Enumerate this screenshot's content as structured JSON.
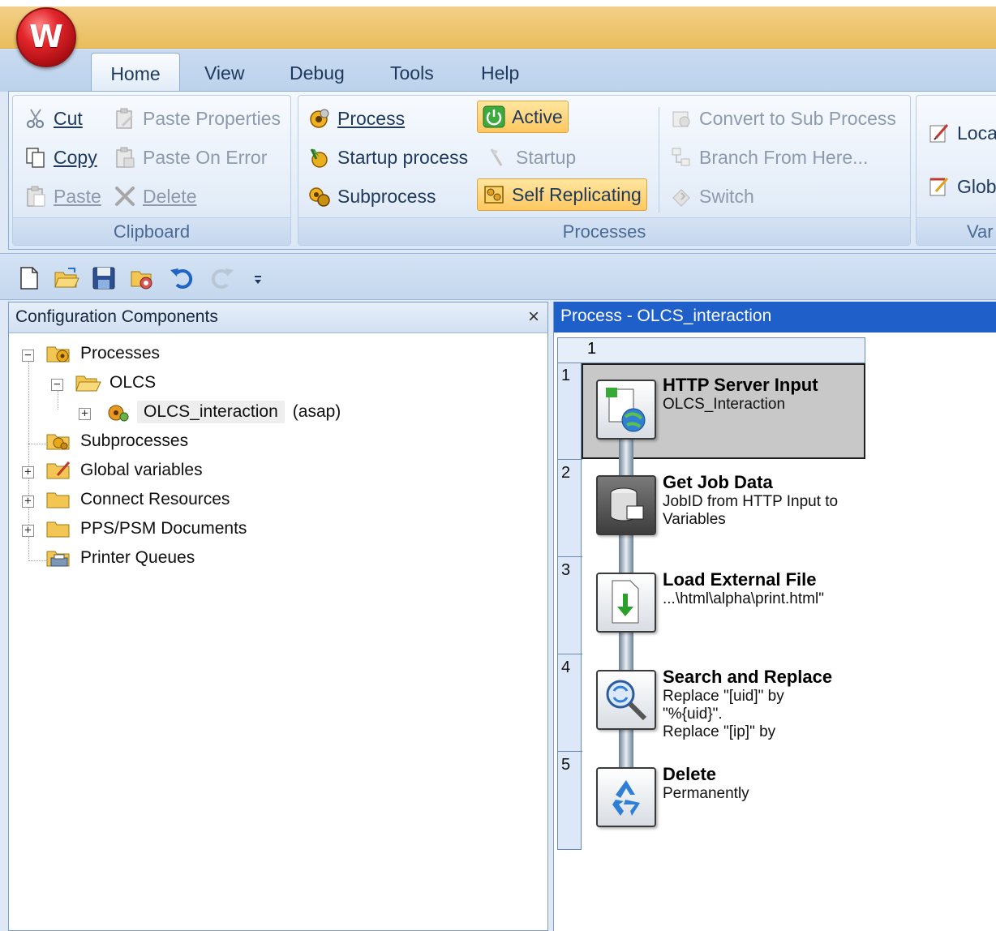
{
  "app": {
    "logo_letter": "W"
  },
  "ribbon_tabs": [
    {
      "label": "Home"
    },
    {
      "label": "View"
    },
    {
      "label": "Debug"
    },
    {
      "label": "Tools"
    },
    {
      "label": "Help"
    }
  ],
  "clipboard": {
    "group_label": "Clipboard",
    "cut": "Cut",
    "copy": "Copy",
    "paste": "Paste",
    "paste_properties": "Paste Properties",
    "paste_on_error": "Paste On Error",
    "delete": "Delete"
  },
  "processes": {
    "group_label": "Processes",
    "process": "Process",
    "startup_process": "Startup process",
    "subprocess": "Subprocess",
    "active": "Active",
    "startup": "Startup",
    "self_replicating": "Self Replicating",
    "convert_to_sub": "Convert to Sub Process",
    "branch_from_here": "Branch From Here...",
    "switch": "Switch"
  },
  "variables": {
    "group_label": "Var",
    "local": "Loca",
    "global": "Glob"
  },
  "left_panel": {
    "title": "Configuration Components",
    "close": "×",
    "tree": {
      "processes": "Processes",
      "olcs": "OLCS",
      "olcs_interaction": "OLCS_interaction",
      "olcs_interaction_suffix": "(asap)",
      "subprocesses": "Subprocesses",
      "global_variables": "Global variables",
      "connect_resources": "Connect Resources",
      "pps_psm": "PPS/PSM Documents",
      "printer_queues": "Printer Queues"
    }
  },
  "right_panel": {
    "title": "Process - OLCS_interaction",
    "column_header": "1",
    "steps": [
      {
        "num": "1",
        "title": "HTTP Server Input",
        "desc": [
          "OLCS_Interaction"
        ]
      },
      {
        "num": "2",
        "title": "Get Job Data",
        "desc": [
          "JobID from HTTP Input to",
          "Variables"
        ]
      },
      {
        "num": "3",
        "title": "Load External File",
        "desc": [
          "...\\html\\alpha\\print.html\""
        ]
      },
      {
        "num": "4",
        "title": "Search and Replace",
        "desc": [
          "Replace \"[uid]\" by",
          "\"%{uid}\".",
          "Replace \"[ip]\" by"
        ]
      },
      {
        "num": "5",
        "title": "Delete",
        "desc": [
          "Permanently"
        ]
      }
    ]
  },
  "colors": {
    "title_bar": "#e9bd5c",
    "ribbon_text": "#1e395b",
    "panel_header_active": "#1f5fc9",
    "highlight": "#ffc861"
  }
}
